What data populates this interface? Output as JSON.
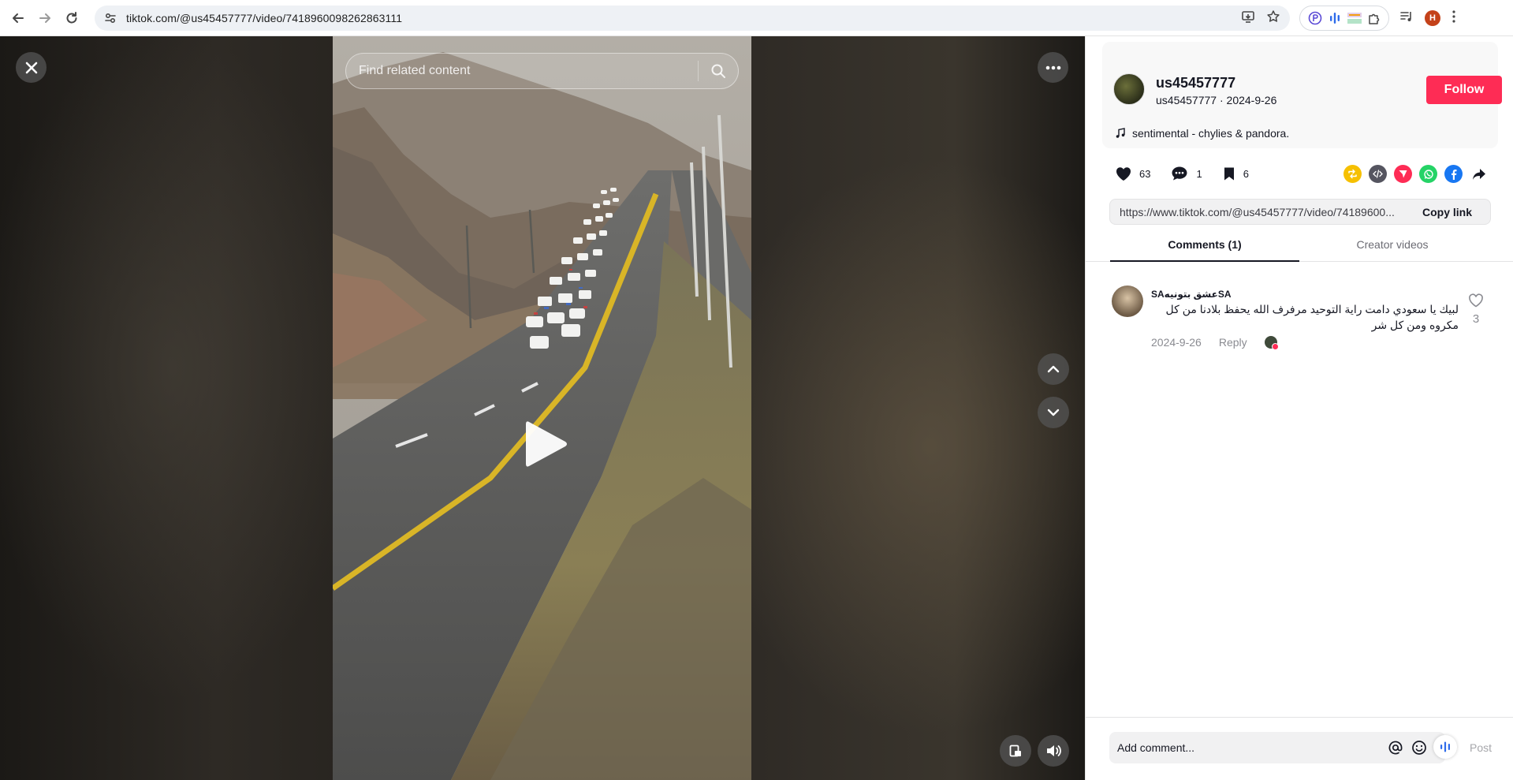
{
  "browser": {
    "url": "tiktok.com/@us45457777/video/7418960098262863111",
    "profile_initial": "H"
  },
  "video": {
    "search_placeholder": "Find related content"
  },
  "author": {
    "name": "us45457777",
    "handle": "us45457777",
    "separator": "·",
    "date": "2024-9-26",
    "follow_label": "Follow",
    "music": "sentimental - chylies & pandora."
  },
  "stats": {
    "likes": "63",
    "comments": "1",
    "saves": "6"
  },
  "share": {
    "link": "https://www.tiktok.com/@us45457777/video/74189600...",
    "copy_label": "Copy link",
    "icons": [
      "repost-icon",
      "embed-icon",
      "send-to-friends-icon",
      "whatsapp-icon",
      "facebook-icon",
      "share-arrow-icon"
    ],
    "colors": {
      "repost": "#f6c000",
      "embed": "#555560",
      "send": "#fe2c55",
      "whatsapp": "#25d366",
      "facebook": "#1877f2"
    }
  },
  "tabs": {
    "comments": "Comments (1)",
    "creator_videos": "Creator videos"
  },
  "comments": [
    {
      "user": "SAعشق بتونيهSA",
      "text": "لبيك يا سعودي دامت راية التوحيد مرفرف الله يحفظ بلادنا من كل مكروه ومن كل شر",
      "date": "2024-9-26",
      "reply_label": "Reply",
      "likes": "3"
    }
  ],
  "composer": {
    "placeholder": "Add comment...",
    "post_label": "Post"
  },
  "colors": {
    "accent": "#fe2c55",
    "text": "#161823"
  }
}
